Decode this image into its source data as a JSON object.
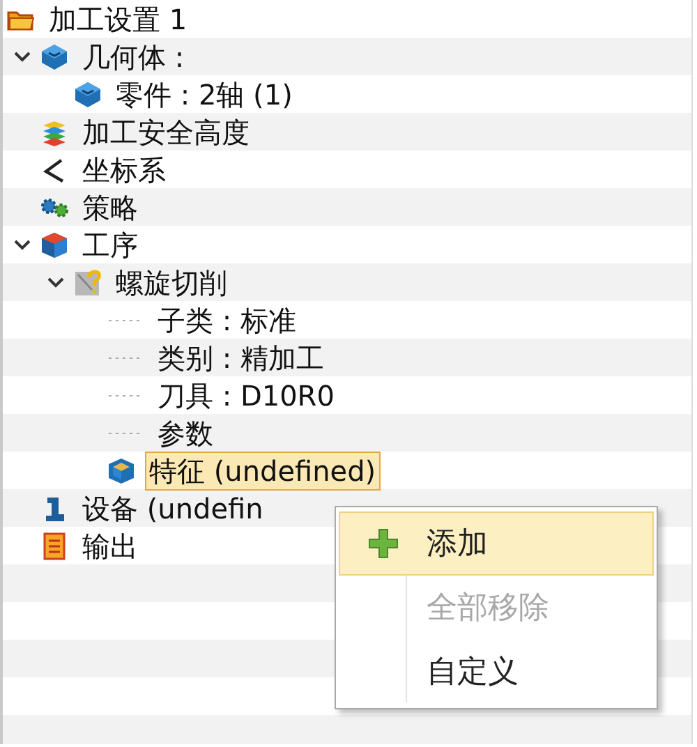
{
  "tree": [
    {
      "label": "加工设置 1",
      "kind": "folder",
      "selected": false,
      "children": [
        {
          "label": "几何体 :",
          "kind": "cube",
          "expanded": true,
          "selected": false,
          "children": [
            {
              "label": "零件 : 2轴 (1)",
              "kind": "part",
              "selected": false
            }
          ]
        },
        {
          "label": "加工安全高度",
          "kind": "layers",
          "selected": false
        },
        {
          "label": "坐标系",
          "kind": "axes",
          "selected": false
        },
        {
          "label": "策略",
          "kind": "gears",
          "selected": false
        },
        {
          "label": "工序",
          "kind": "box",
          "expanded": true,
          "selected": false,
          "children": [
            {
              "label": "螺旋切削",
              "kind": "tool",
              "expanded": true,
              "selected": false,
              "children": [
                {
                  "label": "子类 : 标准",
                  "kind": "property",
                  "selected": false
                },
                {
                  "label": "类别 : 精加工",
                  "kind": "property",
                  "selected": false
                },
                {
                  "label": "刀具 : D10R0",
                  "kind": "property",
                  "selected": false
                },
                {
                  "label": "参数",
                  "kind": "property",
                  "selected": false
                },
                {
                  "label": "特征 (undefined)",
                  "kind": "feature",
                  "selected": true
                }
              ]
            }
          ]
        },
        {
          "label": "设备 (undefin",
          "kind": "machine",
          "selected": false
        },
        {
          "label": "输出",
          "kind": "output",
          "selected": false
        }
      ]
    }
  ],
  "context_menu": [
    {
      "label": "添加",
      "kind": "add",
      "disabled": false,
      "selected": true
    },
    {
      "label": "全部移除",
      "kind": "remove",
      "disabled": true,
      "selected": false
    },
    {
      "label": "自定义",
      "kind": "custom",
      "disabled": false,
      "selected": false
    }
  ]
}
